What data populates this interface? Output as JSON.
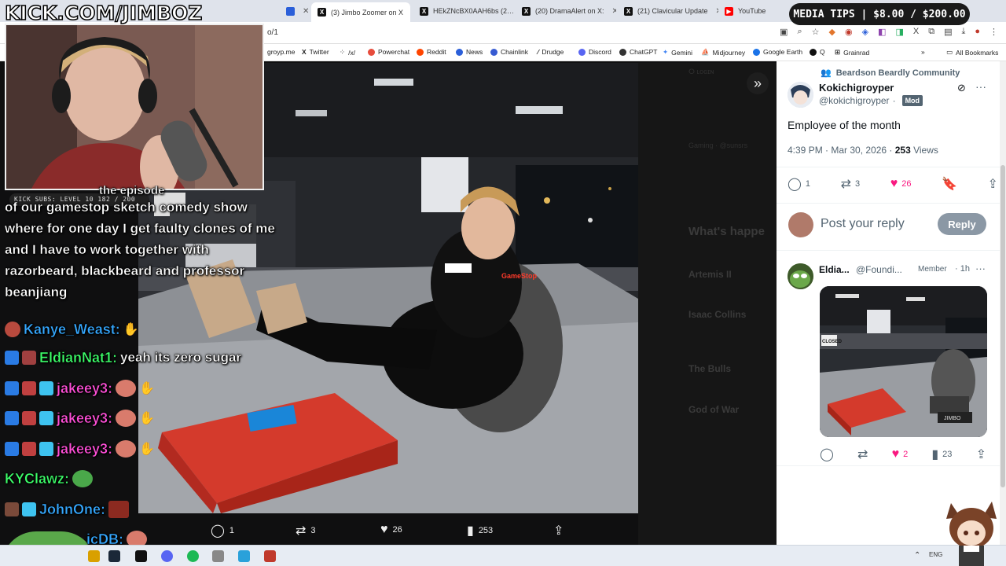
{
  "browser": {
    "tabs": [
      {
        "label": "",
        "icon": "doc"
      },
      {
        "label": "(3) Jimbo Zoomer on X",
        "icon": "X",
        "active": true
      },
      {
        "label": "HEkZNcBX0AAH6bs (2…",
        "icon": "X"
      },
      {
        "label": "(20) DramaAlert on X:",
        "icon": "X"
      },
      {
        "label": "(21) Clavicular Update",
        "icon": "X"
      },
      {
        "label": "YouTube",
        "icon": "youtube"
      }
    ],
    "url": "o/1",
    "bookmarks": [
      {
        "label": "groyp.me"
      },
      {
        "label": "Twitter"
      },
      {
        "label": "/x/"
      },
      {
        "label": "Powerchat"
      },
      {
        "label": "Reddit"
      },
      {
        "label": "News"
      },
      {
        "label": "Chainlink"
      },
      {
        "label": "Drudge"
      },
      {
        "label": "Discord"
      },
      {
        "label": "ChatGPT"
      },
      {
        "label": "Gemini"
      },
      {
        "label": "Midjourney"
      },
      {
        "label": "Google Earth"
      },
      {
        "label": "Q"
      },
      {
        "label": "Grainrad"
      }
    ],
    "all_bookmarks": "All Bookmarks"
  },
  "overlay": {
    "kick_logo": "KICK.COM/JIMBOZ",
    "media_tips": "MEDIA TIPS | $8.00 / $200.00",
    "kick_subs": "KICK SUBS: LEVEL 10 182 / 200",
    "chat_message": "of our gamestop sketch comedy show where for one day I get faulty clones of me and I have to work together with razorbeard, blackbeard and professor beanjiang",
    "chat_message_top": "the episode",
    "chat": [
      {
        "name": "Kanye_Weast:",
        "color": "#35a8ff",
        "text": ""
      },
      {
        "name": "EldianNat1:",
        "color": "#3dff6a",
        "text": "yeah its zero sugar"
      },
      {
        "name": "jakeey3:",
        "color": "#ff4fd8",
        "text": ""
      },
      {
        "name": "jakeey3:",
        "color": "#ff4fd8",
        "text": ""
      },
      {
        "name": "jakeey3:",
        "color": "#ff4fd8",
        "text": ""
      },
      {
        "name": "KYClawz:",
        "color": "#3dff6a",
        "text": ""
      },
      {
        "name": "JohnOne:",
        "color": "#35a8ff",
        "text": ""
      },
      {
        "name": "icDB:",
        "color": "#35a8ff",
        "text": ""
      }
    ]
  },
  "photo_viewer": {
    "replies": "1",
    "reposts": "3",
    "likes": "26",
    "views": "253",
    "closed_sign": "CLOSED",
    "dim_sidebar": {
      "heading": "What's happe",
      "items": [
        "Artemis II",
        "Isaac Collins",
        "The Bulls",
        "God of War"
      ],
      "gaming": "Gaming · @sunsrs"
    }
  },
  "tweet": {
    "community": "Beardson Beardly Community",
    "display_name": "Kokichigroyper",
    "handle": "@kokichigroyper",
    "badge": "Mod",
    "text": "Employee of the month",
    "timestamp": "4:39 PM · Mar 30, 2026 · ",
    "views_count": "253",
    "views_label": " Views",
    "replies": "1",
    "reposts": "3",
    "likes": "26",
    "reply_placeholder": "Post your reply",
    "reply_button": "Reply"
  },
  "reply": {
    "name": "Eldia...",
    "handle": "@Foundi...",
    "member": "Member",
    "time": "· 1h",
    "image_sign": "CLOSED",
    "image_plate": "JIMBO",
    "replies": "",
    "reposts": "",
    "likes": "2",
    "views": "23"
  },
  "taskbar": {
    "lang": "ENG"
  },
  "colors": {
    "like_pink": "#f91880",
    "mod_badge": "#536471",
    "reply_button": "#8b98a5"
  }
}
